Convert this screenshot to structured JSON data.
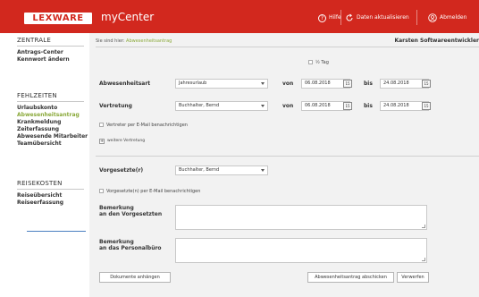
{
  "header": {
    "logo": "LEXWARE",
    "app_title": "myCenter",
    "help": "Hilfe",
    "refresh": "Daten aktualisieren",
    "logout": "Abmelden"
  },
  "sidebar": {
    "sections": [
      {
        "title": "ZENTRALE",
        "items": [
          {
            "label": "Antrags-Center",
            "active": false
          },
          {
            "label": "Kennwort ändern",
            "active": false
          }
        ]
      },
      {
        "title": "FEHLZEITEN",
        "items": [
          {
            "label": "Urlaubskonto",
            "active": false
          },
          {
            "label": "Abwesenheitsantrag",
            "active": true
          },
          {
            "label": "Krankmeldung",
            "active": false
          },
          {
            "label": "Zeiterfassung",
            "active": false
          },
          {
            "label": "Abwesende Mitarbeiter",
            "active": false
          },
          {
            "label": "Teamübersicht",
            "active": false
          }
        ]
      },
      {
        "title": "REISEKOSTEN",
        "items": [
          {
            "label": "Reiseübersicht",
            "active": false
          },
          {
            "label": "Reiseerfassung",
            "active": false
          }
        ]
      }
    ]
  },
  "content": {
    "breadcrumb_prefix": "Sie sind hier:",
    "breadcrumb_current": "Abwesenheitsantrag",
    "user": "Karsten Softwareentwickler",
    "half_day": "½ Tag",
    "absence_type_label": "Abwesenheitsart",
    "absence_type_value": "Jahresurlaub",
    "from_label": "von",
    "to_label": "bis",
    "absence_from": "06.08.2018",
    "absence_to": "24.08.2018",
    "substitute_label": "Vertretung",
    "substitute_value": "Buchhalter, Bernd",
    "substitute_from": "06.08.2018",
    "substitute_to": "24.08.2018",
    "cal_icon": "15",
    "notify_substitute": "Vertreter per E-Mail benachrichtigen",
    "more_substitutes": "weitere Vertretung",
    "supervisor_label": "Vorgesetzte(r)",
    "supervisor_value": "Buchhalter, Bernd",
    "notify_supervisor": "Vorgesetzte(n) per E-Mail benachrichtigen",
    "remark_supervisor_line1": "Bemerkung",
    "remark_supervisor_line2": "an den Vorgesetzten",
    "remark_hr_line1": "Bemerkung",
    "remark_hr_line2": "an das Personalbüro",
    "attach_button": "Dokumente anhängen",
    "submit_button": "Abwesenheitsantrag abschicken",
    "discard_button": "Verwerfen"
  },
  "colors": {
    "brand_red": "#d2281e",
    "active_green": "#8aa93a",
    "content_bg": "#f2f2f2"
  }
}
